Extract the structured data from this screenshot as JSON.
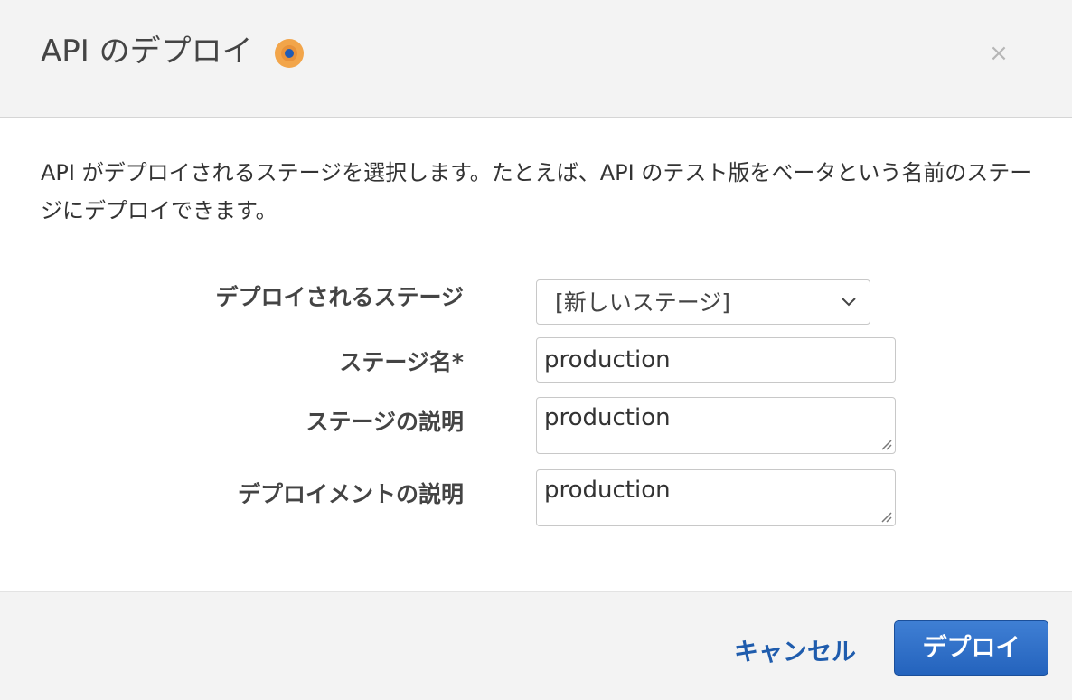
{
  "dialog": {
    "title": "API のデプロイ",
    "close_label": "×",
    "description": "API がデプロイされるステージを選択します。たとえば、API のテスト版をベータという名前のステージにデプロイできます。"
  },
  "form": {
    "stage_label": "デプロイされるステージ",
    "stage_value": "[新しいステージ]",
    "stage_name_label": "ステージ名*",
    "stage_name_value": "production",
    "stage_description_label": "ステージの説明",
    "stage_description_value": "production",
    "deployment_description_label": "デプロイメントの説明",
    "deployment_description_value": "production"
  },
  "footer": {
    "cancel_label": "キャンセル",
    "deploy_label": "デプロイ"
  },
  "colors": {
    "primary": "#2463bd",
    "link": "#1f5cad",
    "info_icon": "#f2a54a",
    "header_bg": "#f3f3f3"
  },
  "icons": [
    "info-icon",
    "close-icon",
    "chevron-down-icon",
    "resize-handle-icon"
  ]
}
